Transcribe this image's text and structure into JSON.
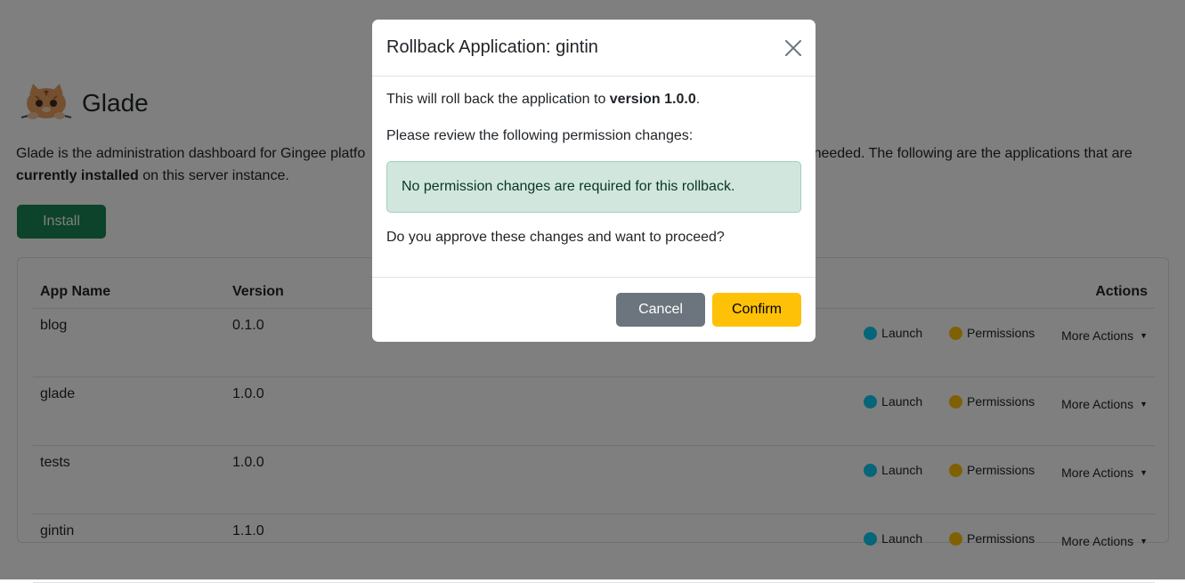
{
  "app": {
    "title": "Glade",
    "intro_start": "Glade is the administration dashboard for Gingee platfo",
    "intro_mid": "as needed. The following are the applications that are ",
    "intro_bold": "currently installed",
    "intro_end": " on this server instance.",
    "install_label": "Install"
  },
  "table": {
    "headers": {
      "name": "App Name",
      "version": "Version",
      "actions": "Actions"
    },
    "rows": [
      {
        "name": "blog",
        "version": "0.1.0"
      },
      {
        "name": "glade",
        "version": "1.0.0"
      },
      {
        "name": "tests",
        "version": "1.0.0"
      },
      {
        "name": "gintin",
        "version": "1.1.0"
      }
    ],
    "actions": {
      "launch": "Launch",
      "permissions": "Permissions",
      "more": "More Actions"
    }
  },
  "modal": {
    "title": "Rollback Application: gintin",
    "body_prefix": "This will roll back the application to ",
    "body_version": "version 1.0.0",
    "body_suffix": ".",
    "review_text": "Please review the following permission changes:",
    "alert_text": "No permission changes are required for this rollback.",
    "approve_text": "Do you approve these changes and want to proceed?",
    "cancel_label": "Cancel",
    "confirm_label": "Confirm"
  },
  "colors": {
    "install": "#198754",
    "launch_dot": "#0dcaf0",
    "permissions_dot": "#ffc107",
    "cancel": "#6c757d",
    "confirm": "#ffc107",
    "alert_bg": "#d1e7dd"
  },
  "icons": {
    "logo": "cat-logo-icon",
    "close": "close-icon",
    "caret": "caret-down-icon"
  }
}
